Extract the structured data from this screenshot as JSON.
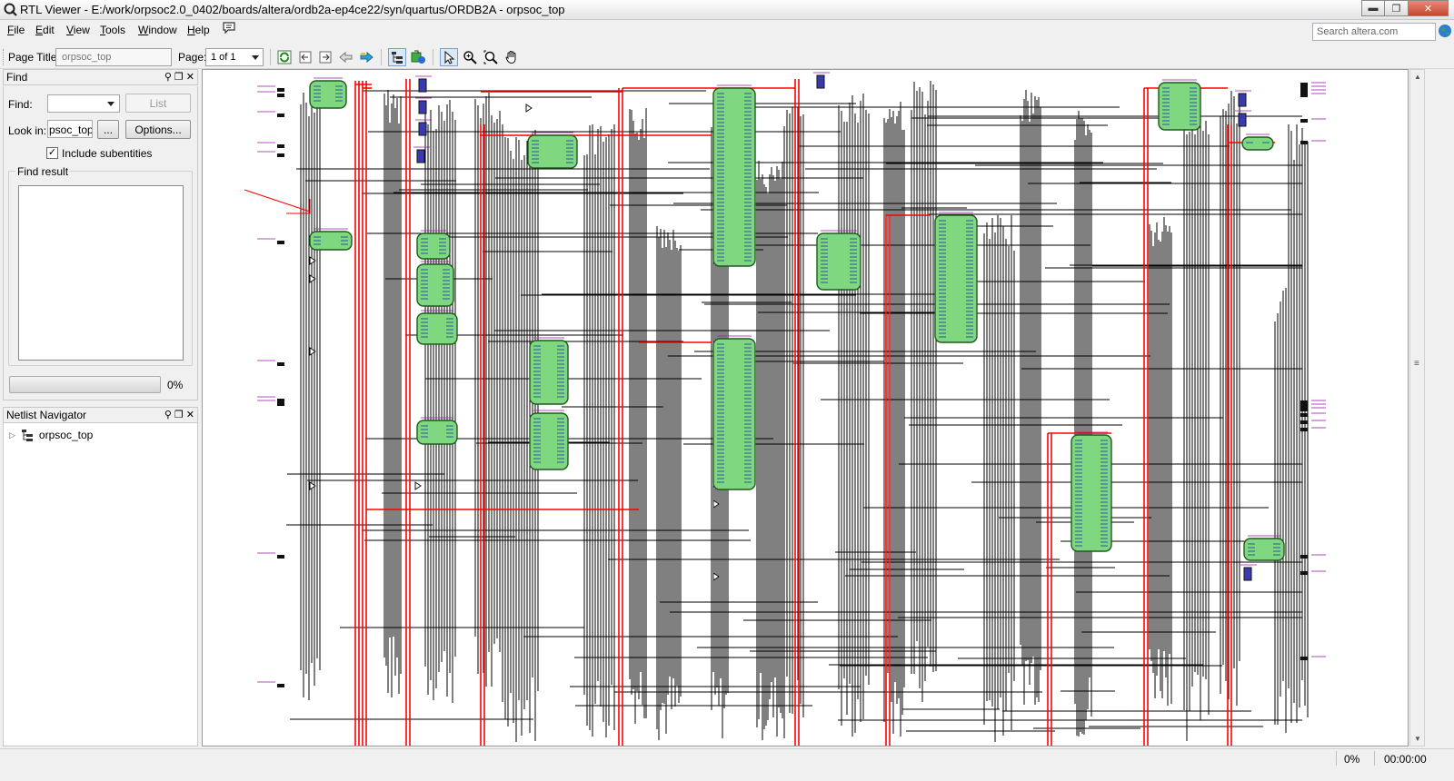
{
  "window": {
    "title": "RTL Viewer - E:/work/orpsoc2.0_0402/boards/altera/ordb2a-ep4ce22/syn/quartus/ORDB2A - orpsoc_top"
  },
  "menu": {
    "items": [
      {
        "label": "File",
        "mnemonic": "F",
        "rest": "ile"
      },
      {
        "label": "Edit",
        "mnemonic": "E",
        "rest": "dit"
      },
      {
        "label": "View",
        "mnemonic": "V",
        "rest": "iew"
      },
      {
        "label": "Tools",
        "mnemonic": "T",
        "rest": "ools"
      },
      {
        "label": "Window",
        "mnemonic": "W",
        "rest": "indow"
      },
      {
        "label": "Help",
        "mnemonic": "H",
        "rest": "elp"
      }
    ],
    "search_placeholder": "Search altera.com"
  },
  "toolbar": {
    "page_title_label": "Page Title:",
    "page_title_value": "orpsoc_top",
    "page_label": "Page:",
    "page_value": "1 of 1"
  },
  "find_panel": {
    "title": "Find",
    "find_label": "Find:",
    "find_value": "",
    "list_button": "List",
    "look_in_label": "Look in:",
    "look_in_value": "psoc_top",
    "browse_button": "...",
    "options_button": "Options...",
    "include_subentities_label": "Include subentities",
    "include_subentities_checked": true,
    "find_result_label": "Find result",
    "progress_text": "0%",
    "progress_value": 0
  },
  "netlist_navigator": {
    "title": "Netlist Navigator",
    "root_item": "orpsoc_top"
  },
  "statusbar": {
    "progress": "0%",
    "time": "00:00:00"
  },
  "colors": {
    "block_fill": "#7fd77f",
    "wire_black": "#000000",
    "wire_red": "#ff0000",
    "register_fill": "#3a3ab0"
  }
}
